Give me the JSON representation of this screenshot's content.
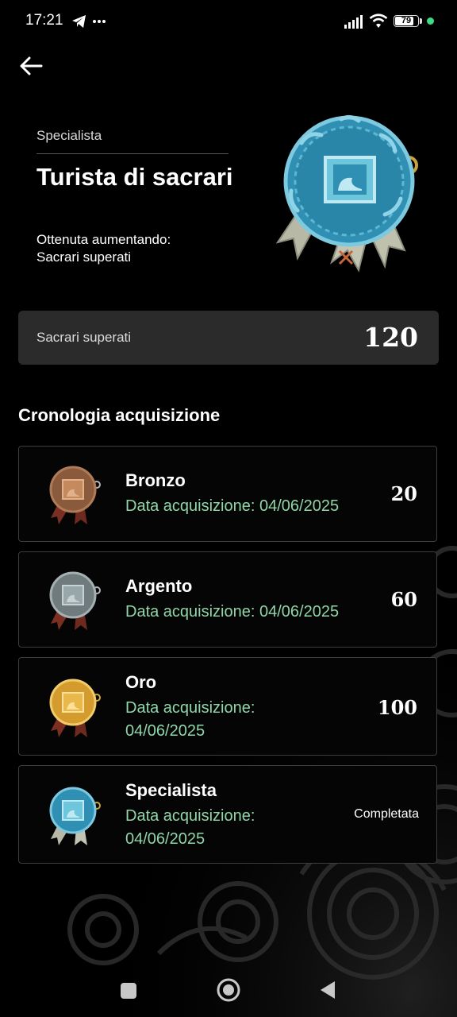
{
  "status_bar": {
    "time": "17:21",
    "battery": "79",
    "battery_level": 0.79,
    "icons": [
      "telegram-icon",
      "more-dots-icon",
      "signal-icon",
      "wifi-icon",
      "battery-icon"
    ]
  },
  "header": {
    "back_icon": "arrow-left-icon"
  },
  "achievement": {
    "kicker": "Specialista",
    "title": "Turista di sacrari",
    "subtitle_line1": "Ottenuta aumentando:",
    "subtitle_line2": "Sacrari superati",
    "medal": "specialist-medal-icon"
  },
  "summary": {
    "label": "Sacrari superati",
    "value": "120"
  },
  "history": {
    "title": "Cronologia acquisizione",
    "items": [
      {
        "tier": "Bronzo",
        "date_label": "Data acquisizione: 04/06/2025",
        "date_prefix": "Data acquisizione:",
        "date": "04/06/2025",
        "value": "20",
        "color": "#8a5a3c"
      },
      {
        "tier": "Argento",
        "date_label": "Data acquisizione: 04/06/2025",
        "date_prefix": "Data acquisizione:",
        "date": "04/06/2025",
        "value": "60",
        "color": "#7d8a8c"
      },
      {
        "tier": "Oro",
        "date_label": "Data acquisizione:",
        "date_prefix": "Data acquisizione:",
        "date": "04/06/2025",
        "value": "100",
        "color": "#d9a23a"
      },
      {
        "tier": "Specialista",
        "date_label": "Data acquisizione:",
        "date_prefix": "Data acquisizione:",
        "date": "04/06/2025",
        "status": "Completata",
        "color": "#3fa3c4"
      }
    ]
  },
  "colors": {
    "accent_green": "#8fd6a8",
    "summary_bg": "#2b2b2b",
    "card_border": "#3d3d3d"
  },
  "nav": {
    "icons": [
      "recents-square-icon",
      "home-circle-icon",
      "back-triangle-icon"
    ]
  }
}
